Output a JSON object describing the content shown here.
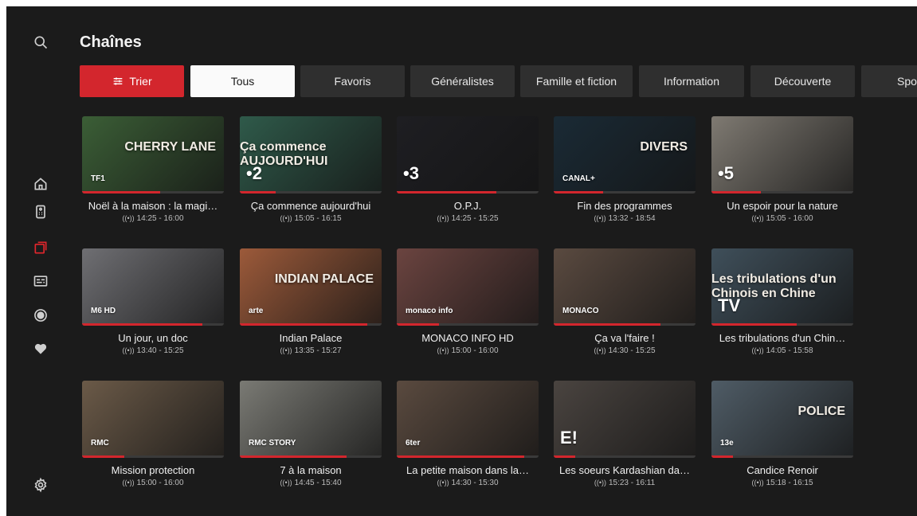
{
  "page_title": "Chaînes",
  "sort_button": {
    "label": "Trier"
  },
  "filters": [
    "Tous",
    "Favoris",
    "Généralistes",
    "Famille et fiction",
    "Information",
    "Découverte",
    "Spo"
  ],
  "selected_filter": "Tous",
  "live_marker": "((•))",
  "colors": {
    "accent": "#d3262d",
    "background": "#1b1b1b",
    "chip": "#2f2f2f"
  },
  "rail_icons": [
    "search-icon",
    "home-icon",
    "remote-icon",
    "channels-icon",
    "guide-icon",
    "record-icon",
    "favorites-icon",
    "settings-icon"
  ],
  "channels": [
    {
      "title": "Noël à la maison : la magi…",
      "time": "14:25 - 16:00",
      "logo": "TF1",
      "overlay": "CHERRY LANE",
      "progress": 0.55,
      "thumb": "#3b5e36"
    },
    {
      "title": "Ça commence aujourd'hui",
      "time": "15:05 - 16:15",
      "logo": "•2",
      "overlay": "Ça commence AUJOURD'HUI",
      "progress": 0.25,
      "thumb": "#2f5a4a"
    },
    {
      "title": "O.P.J.",
      "time": "14:25 - 15:25",
      "logo": "•3",
      "overlay": "",
      "progress": 0.7,
      "thumb": "#1e1e22"
    },
    {
      "title": "Fin des programmes",
      "time": "13:32 - 18:54",
      "logo": "CANAL+",
      "overlay": "DIVERS",
      "progress": 0.35,
      "thumb": "#1a2a35"
    },
    {
      "title": "Un espoir pour la nature",
      "time": "15:05 - 16:00",
      "logo": "•5",
      "overlay": "",
      "progress": 0.35,
      "thumb": "#7f7a72"
    },
    {
      "title": "Un jour, un doc",
      "time": "13:40 - 15:25",
      "logo": "M6 HD",
      "overlay": "",
      "progress": 0.85,
      "thumb": "#6f6f73"
    },
    {
      "title": "Indian Palace",
      "time": "13:35 - 15:27",
      "logo": "arte",
      "overlay": "INDIAN PALACE",
      "progress": 0.9,
      "thumb": "#9c5a3a"
    },
    {
      "title": "MONACO INFO HD",
      "time": "15:00 - 16:00",
      "logo": "monaco info",
      "overlay": "",
      "progress": 0.3,
      "thumb": "#6b4440"
    },
    {
      "title": "Ça va l'faire !",
      "time": "14:30 - 15:25",
      "logo": "MONACO",
      "overlay": "",
      "progress": 0.75,
      "thumb": "#5a4a40"
    },
    {
      "title": "Les tribulations d'un Chin…",
      "time": "14:05 - 15:58",
      "logo": "TV",
      "overlay": "Les tribulations d'un Chinois en Chine",
      "progress": 0.6,
      "thumb": "#3f4f5a"
    },
    {
      "title": "Mission protection",
      "time": "15:00 - 16:00",
      "logo": "RMC",
      "overlay": "",
      "progress": 0.3,
      "thumb": "#6b5a48"
    },
    {
      "title": "7 à la maison",
      "time": "14:45 - 15:40",
      "logo": "RMC STORY",
      "overlay": "",
      "progress": 0.75,
      "thumb": "#7a7a74"
    },
    {
      "title": "La petite maison dans la…",
      "time": "14:30 - 15:30",
      "logo": "6ter",
      "overlay": "",
      "progress": 0.9,
      "thumb": "#5a4a3f"
    },
    {
      "title": "Les soeurs Kardashian da…",
      "time": "15:23 - 16:11",
      "logo": "E!",
      "overlay": "",
      "progress": 0.15,
      "thumb": "#4a4440"
    },
    {
      "title": "Candice Renoir",
      "time": "15:18 - 16:15",
      "logo": "13e",
      "overlay": "POLICE",
      "progress": 0.15,
      "thumb": "#4f5c66"
    }
  ]
}
